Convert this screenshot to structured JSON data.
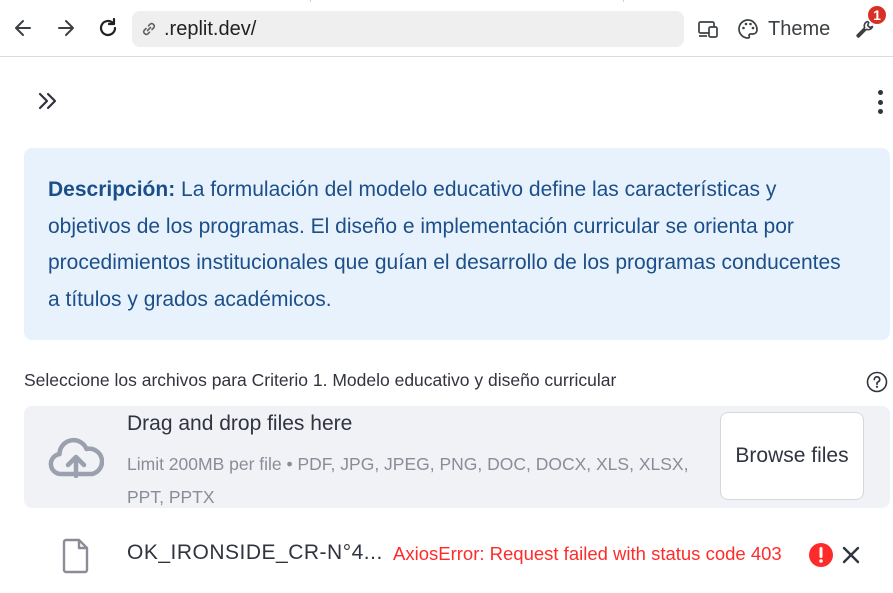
{
  "browser": {
    "url": ".replit.dev/",
    "theme_label": "Theme",
    "notification_count": "1",
    "icons": {
      "back": "arrow-left-icon",
      "forward": "arrow-right-icon",
      "reload": "reload-icon",
      "link": "link-icon",
      "devices": "devices-icon",
      "theme": "palette-icon",
      "tools": "wrench-icon"
    }
  },
  "app": {
    "info": {
      "label": "Descripción:",
      "text": " La formulación del modelo educativo define las características y objetivos de los programas. El diseño e implementación curricular se orienta por procedimientos institucionales que guían el desarrollo de los programas conducentes a títulos y grados académicos."
    },
    "uploader": {
      "label": "Seleccione los archivos para Criterio 1. Modelo educativo y diseño curricular",
      "dropzone_title": "Drag and drop files here",
      "dropzone_limit": "Limit 200MB per file • PDF, JPG, JPEG, PNG, DOC, DOCX, XLS, XLSX, PPT, PPTX",
      "browse_label": "Browse files"
    },
    "file": {
      "name": "OK_IRONSIDE_CR-N°4...",
      "error": "AxiosError: Request failed with status code 403"
    }
  },
  "colors": {
    "info_bg": "#e8f2fc",
    "info_text": "#1c4f8a",
    "dropzone_bg": "#f0f2f6",
    "error": "#ff2b2b",
    "badge": "#d93025"
  }
}
